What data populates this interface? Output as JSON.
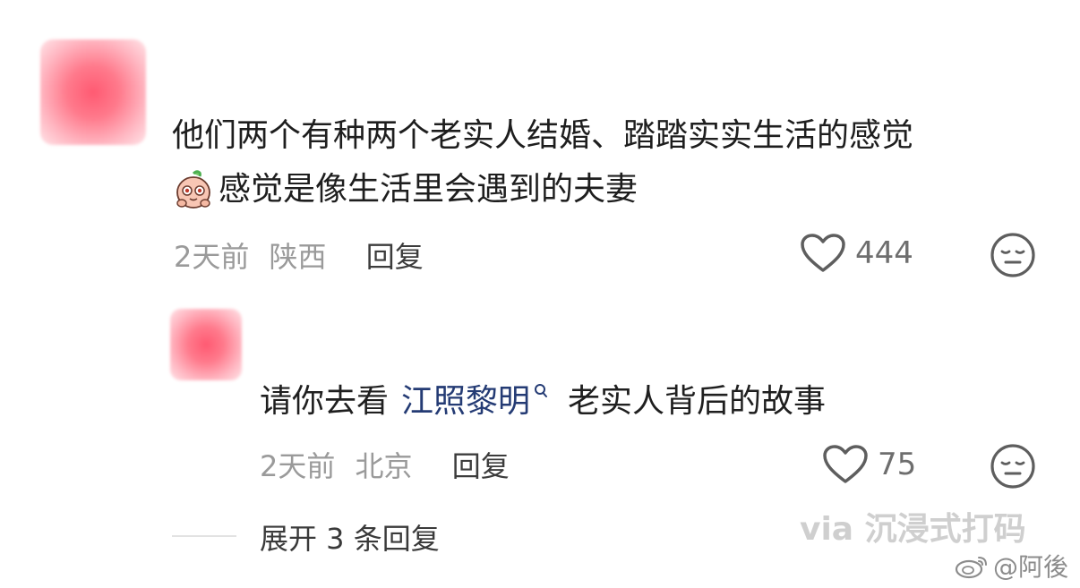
{
  "comment": {
    "line1": "他们两个有种两个老实人结婚、踏踏实实生活的感觉",
    "line2": "感觉是像生活里会遇到的夫妻",
    "time": "2天前",
    "location": "陕西",
    "reply_label": "回复",
    "likes": "444",
    "sticker_icon": "peach-sticker",
    "avatar_color": "#ff6b80"
  },
  "reply": {
    "text_before": "请你去看",
    "mention": "江照黎明",
    "text_after": "老实人背后的故事",
    "time": "2天前",
    "location": "北京",
    "reply_label": "回复",
    "likes": "75",
    "mention_color": "#243b74"
  },
  "expand_label": "展开 3 条回复",
  "watermark": {
    "line1": "via 沉浸式打码",
    "line2": "@阿後"
  },
  "icons": {
    "like": "heart-outline-icon",
    "dislike": "neutral-face-icon",
    "search": "search-icon",
    "weibo": "weibo-logo"
  }
}
